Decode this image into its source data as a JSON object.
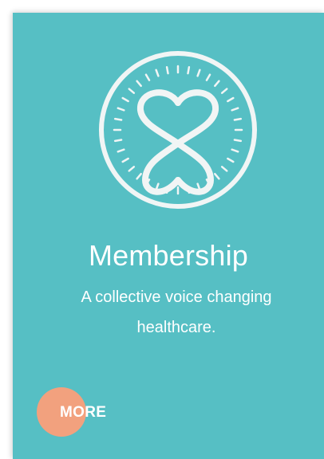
{
  "card": {
    "background_color": "#56bfc4",
    "icon": "membership-emblem-icon",
    "title": "Membership",
    "subtitle": "A collective voice changing healthcare.",
    "more_button": {
      "label": "MORE",
      "accent_color": "#f2a17e"
    }
  }
}
